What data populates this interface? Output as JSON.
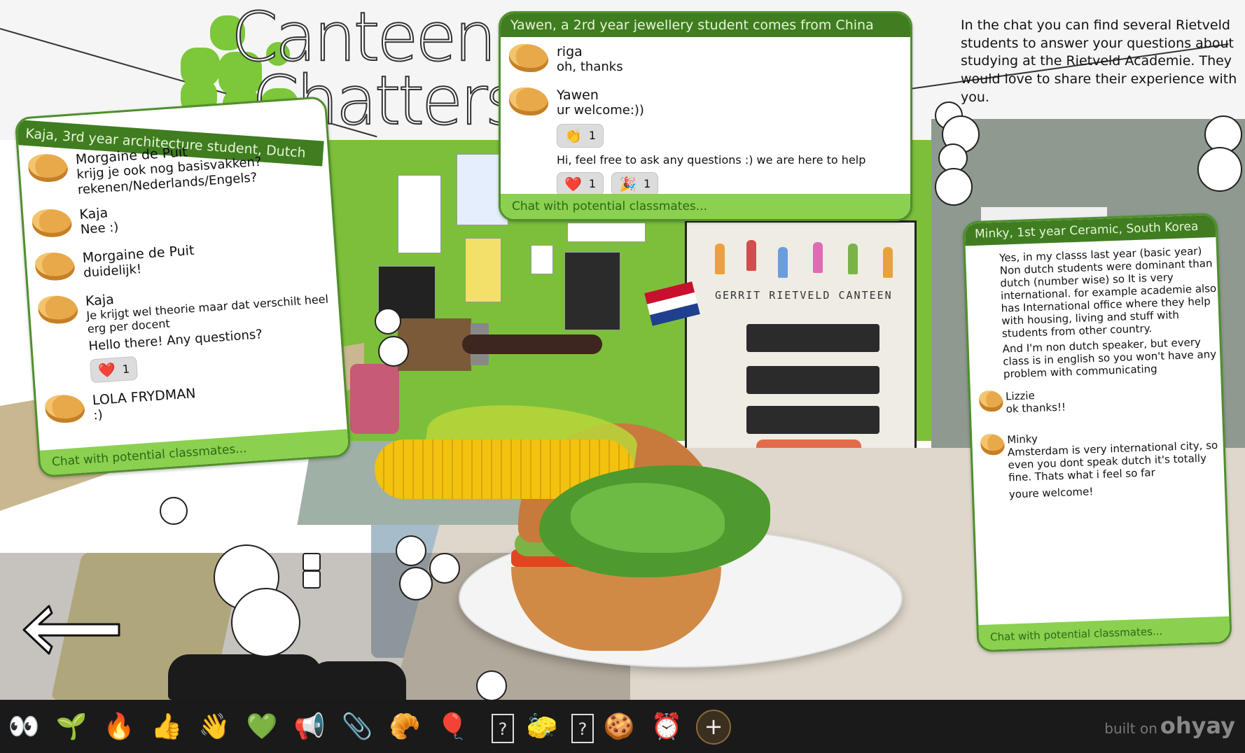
{
  "logo": {
    "line1": "Canteen",
    "line2": "Chatters"
  },
  "intro": "In the chat you can find several Rietveld students to answer your questions about studying at the Rietveld Academie. They would love to share their experience with you.",
  "painting_text": "GERRIT  RIETVELD  CANTEEN",
  "panels": {
    "kaja": {
      "title": "Kaja, 3rd year architecture student, Dutch",
      "footer": "Chat with potential classmates...",
      "messages": [
        {
          "name": "Morgaine de Puit",
          "text": "krijg je ook nog basisvakken? rekenen/Nederlands/Engels?"
        },
        {
          "name": "Kaja",
          "text": "Nee :)"
        },
        {
          "name": "Morgaine de Puit",
          "text": "duidelijk!"
        },
        {
          "name": "Kaja",
          "text": "Je krijgt wel theorie maar dat verschilt heel erg per docent",
          "text2": "Hello there! Any questions?",
          "reaction": {
            "emoji": "❤️",
            "count": "1"
          }
        },
        {
          "name": "LOLA FRYDMAN",
          "text": ":)"
        }
      ]
    },
    "yawen": {
      "title": "Yawen, a 2rd year jewellery student comes from China",
      "footer": "Chat with potential classmates...",
      "messages": [
        {
          "name": "riga",
          "text": "oh, thanks"
        },
        {
          "name": "Yawen",
          "text": "ur welcome:))",
          "reaction": {
            "emoji": "👏",
            "count": "1"
          },
          "text2": "Hi, feel free to ask any questions :) we are here to help",
          "reactions2": [
            {
              "emoji": "❤️",
              "count": "1"
            },
            {
              "emoji": "🎉",
              "count": "1"
            }
          ]
        }
      ]
    },
    "minky": {
      "title": "Minky, 1st year Ceramic, South Korea",
      "footer": "Chat with potential classmates...",
      "messages": [
        {
          "name": "",
          "text": "Yes, in my classs last year (basic year) Non dutch students were dominant than dutch (number wise) so It is very international. for example academie also has International office where they help with housing, living and stuff with students from other country.",
          "text2": "And I'm non dutch speaker, but every class is in english so you won't have any problem with communicating"
        },
        {
          "name": "Lizzie",
          "text": "ok thanks!!"
        },
        {
          "name": "Minky",
          "text": "Amsterdam is very international city, so even you dont speak dutch it's totally fine. Thats what i feel so far",
          "text2": "youre welcome!"
        }
      ]
    }
  },
  "toolbar": {
    "items": [
      {
        "icon": "eyes-icon",
        "glyph": "👀"
      },
      {
        "icon": "seedling-icon",
        "glyph": "🌱"
      },
      {
        "icon": "fire-icon",
        "glyph": "🔥"
      },
      {
        "icon": "thumbs-up-icon",
        "glyph": "👍"
      },
      {
        "icon": "waving-hand-icon",
        "glyph": "👋"
      },
      {
        "icon": "green-heart-icon",
        "glyph": "💚"
      },
      {
        "icon": "megaphone-icon",
        "glyph": "📢"
      },
      {
        "icon": "paperclip-icon",
        "glyph": "📎"
      },
      {
        "icon": "croissant-icon",
        "glyph": "🥐"
      },
      {
        "icon": "balloon-icon",
        "glyph": "🎈"
      },
      {
        "icon": "unknown-icon",
        "glyph": "?"
      },
      {
        "icon": "sponge-icon",
        "glyph": "🧽"
      },
      {
        "icon": "unknown-icon",
        "glyph": "?"
      },
      {
        "icon": "cookie-icon",
        "glyph": "🍪"
      },
      {
        "icon": "alarm-clock-icon",
        "glyph": "⏰"
      },
      {
        "icon": "add-icon",
        "glyph": "+"
      }
    ],
    "built_on": "built on",
    "brand": "ohyay"
  }
}
